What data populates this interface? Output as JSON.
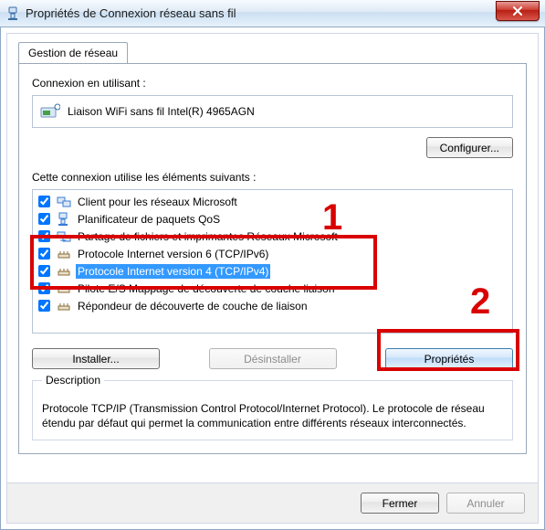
{
  "window": {
    "title": "Propriétés de Connexion réseau sans fil"
  },
  "tab": {
    "label": "Gestion de réseau"
  },
  "adapter": {
    "label": "Connexion en utilisant :",
    "name": "Liaison WiFi sans fil Intel(R) 4965AGN",
    "configure": "Configurer..."
  },
  "components": {
    "label": "Cette connexion utilise les éléments suivants :",
    "items": [
      {
        "label": "Client pour les réseaux Microsoft",
        "checked": true,
        "selected": false,
        "icon": "client-icon"
      },
      {
        "label": "Planificateur de paquets QoS",
        "checked": true,
        "selected": false,
        "icon": "qos-icon"
      },
      {
        "label": "Partage de fichiers et imprimantes Réseaux Microsoft",
        "checked": true,
        "selected": false,
        "icon": "share-icon"
      },
      {
        "label": "Protocole Internet version 6 (TCP/IPv6)",
        "checked": true,
        "selected": false,
        "icon": "protocol-icon"
      },
      {
        "label": "Protocole Internet version 4 (TCP/IPv4)",
        "checked": true,
        "selected": true,
        "icon": "protocol-icon"
      },
      {
        "label": "Pilote E/S Mappage de découverte de couche liaison",
        "checked": true,
        "selected": false,
        "icon": "driver-icon"
      },
      {
        "label": "Répondeur de découverte de couche de liaison",
        "checked": true,
        "selected": false,
        "icon": "responder-icon"
      }
    ]
  },
  "buttons": {
    "install": "Installer...",
    "uninstall": "Désinstaller",
    "properties": "Propriétés"
  },
  "description": {
    "heading": "Description",
    "text": "Protocole TCP/IP (Transmission Control Protocol/Internet Protocol). Le protocole de réseau étendu par défaut qui permet la communication entre différents réseaux interconnectés."
  },
  "footer": {
    "close": "Fermer",
    "cancel": "Annuler"
  },
  "annotations": {
    "one": "1",
    "two": "2"
  },
  "icons": {
    "client-icon": "#3a7bd5",
    "qos-icon": "#3a7bd5",
    "share-icon": "#3a7bd5",
    "protocol-icon": "#8a6d3b",
    "driver-icon": "#8a6d3b",
    "responder-icon": "#8a6d3b"
  }
}
